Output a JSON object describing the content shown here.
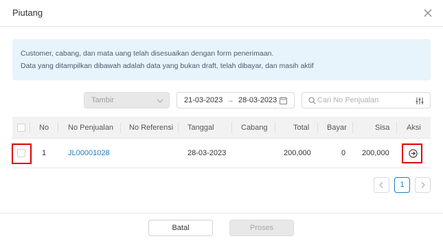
{
  "modal": {
    "title": "Piutang"
  },
  "info": {
    "line1": "Customer, cabang, dan mata uang telah disesuaikan dengan form penerimaan.",
    "line2": "Data yang ditampilkan dibawah adalah data yang bukan draft, telah dibayar, dan masih aktif"
  },
  "filters": {
    "type_value": "Tambir",
    "date_start": "21-03-2023",
    "date_arrow": "→",
    "date_end": "28-03-2023",
    "search_placeholder": "Cari No Penjualan",
    "search_value": ""
  },
  "table": {
    "headers": {
      "no": "No",
      "no_penjualan": "No Penjualan",
      "no_referensi": "No Referensi",
      "tanggal": "Tanggal",
      "cabang": "Cabang",
      "total": "Total",
      "bayar": "Bayar",
      "sisa": "Sisa",
      "aksi": "Aksi"
    },
    "rows": [
      {
        "no": "1",
        "no_penjualan": "JL00001028",
        "no_referensi": "",
        "tanggal": "28-03-2023",
        "cabang": "",
        "total": "200,000",
        "bayar": "0",
        "sisa": "200,000",
        "checked": false
      }
    ]
  },
  "pagination": {
    "current_page": "1"
  },
  "footer": {
    "cancel_label": "Batal",
    "process_label": "Proses"
  },
  "colors": {
    "link": "#1a7fc1",
    "highlight": "#e00000",
    "info_bg": "#e8f4fb"
  }
}
